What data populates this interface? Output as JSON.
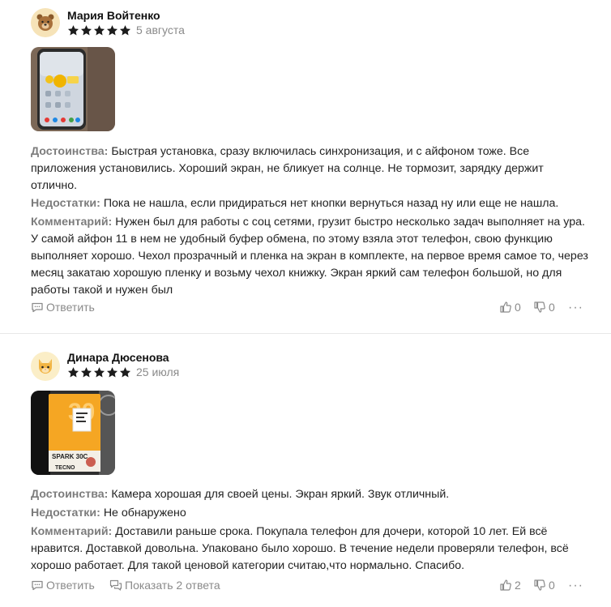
{
  "reviews": [
    {
      "author": "Мария Войтенко",
      "rating": 5,
      "date": "5 августа",
      "advantages_label": "Достоинства:",
      "advantages_lines": [
        "Быстрая установка, сразу включилась синхронизация, и с айфоном тоже. Все",
        "приложения установились. Хороший экран, не бликует на солнце. Не тормозит, зарядку держит",
        "отлично."
      ],
      "disadvantages_label": "Недостатки:",
      "disadvantages": "Пока не нашла, если придираться нет кнопки вернуться назад ну или еще не нашла.",
      "comment_label": "Комментарий:",
      "comment_lines": [
        "Нужен был для работы с соц сетями, грузит быстро несколько задач выполняет на ура.",
        "У самой айфон 11 в нем не удобный буфер обмена, по этому взяла этот телефон, свою функцию",
        "выполняет хорошо. Чехол прозрачный и пленка на экран в комплекте, на первое время самое то, через",
        "месяц закатаю хорошую пленку и возьму чехол книжку. Экран яркий сам телефон большой, но для",
        "работы такой и нужен был"
      ],
      "reply_label": "Ответить",
      "likes": "0",
      "dislikes": "0",
      "more_icon": "···"
    },
    {
      "author": "Динара Дюсенова",
      "rating": 5,
      "date": "25 июля",
      "advantages_label": "Достоинства:",
      "advantages": "Камера хорошая для своей цены. Экран яркий. Звук отличный.",
      "disadvantages_label": "Недостатки:",
      "disadvantages": "Не обнаружено",
      "comment_label": "Комментарий:",
      "comment_lines": [
        "Доставили раньше срока. Покупала телефон для дочери, которой 10 лет. Ей всё",
        "нравится. Доставкой довольна. Упаковано было хорошо. В течение недели проверяли телефон, всё",
        "хорошо работает. Для такой ценовой категории считаю,что нормально. Спасибо."
      ],
      "reply_label": "Ответить",
      "show_replies_label": "Показать 2 ответа",
      "likes": "2",
      "dislikes": "0",
      "more_icon": "···"
    }
  ],
  "colors": {
    "star": "#1c1c1c",
    "label": "#7c7c7c",
    "muted": "#8a8a8a",
    "divider": "#e8e8e8"
  }
}
